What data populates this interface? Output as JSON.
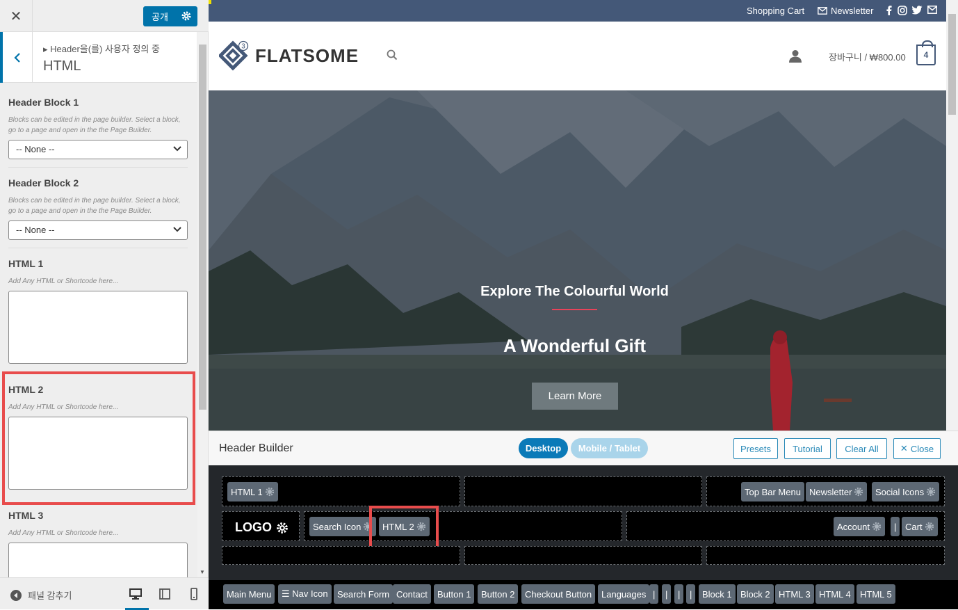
{
  "panel": {
    "close_label": "✕",
    "publish_label": "공개",
    "breadcrumb": "▸ Header을(를) 사용자 정의 중",
    "title": "HTML",
    "sections": {
      "header_block_1": {
        "title": "Header Block 1",
        "desc": "Blocks can be edited in the page builder. Select a block, go to a page and open in the the Page Builder.",
        "value": "-- None --"
      },
      "header_block_2": {
        "title": "Header Block 2",
        "desc": "Blocks can be edited in the page builder. Select a block, go to a page and open in the the Page Builder.",
        "value": "-- None --"
      },
      "html_1": {
        "title": "HTML 1",
        "desc": "Add Any HTML or Shortcode here..."
      },
      "html_2": {
        "title": "HTML 2",
        "desc": "Add Any HTML or Shortcode here..."
      },
      "html_3": {
        "title": "HTML 3",
        "desc": "Add Any HTML or Shortcode here..."
      }
    },
    "footer": {
      "hide_label": "패널 감추기"
    }
  },
  "preview": {
    "topbar": {
      "cart": "Shopping Cart",
      "newsletter": "Newsletter"
    },
    "header": {
      "logo_text": "FLATSOME",
      "logo_badge": "3",
      "cart_text": "장바구니 / ₩800.00",
      "cart_count": "4"
    },
    "hero": {
      "subtitle": "Explore The Colourful World",
      "title": "A Wonderful Gift",
      "button": "Learn More"
    }
  },
  "builder": {
    "title": "Header Builder",
    "desktop": "Desktop",
    "mobile": "Mobile / Tablet",
    "presets": "Presets",
    "tutorial": "Tutorial",
    "clear_all": "Clear All",
    "close": "Close",
    "top_left": [
      "HTML 1"
    ],
    "top_right": [
      "Top Bar Menu",
      "Newsletter",
      "Social Icons"
    ],
    "main_logo": "LOGO",
    "main_left": [
      "Search Icon",
      "HTML 2"
    ],
    "main_right": [
      "Account",
      "|",
      "Cart"
    ],
    "elements": [
      "Main Menu",
      "☰ Nav Icon",
      "Search Form",
      "Contact",
      "Button 1",
      "Button 2",
      "Checkout Button",
      "Languages",
      "|",
      "|",
      "|",
      "|",
      "Block 1",
      "Block 2",
      "HTML 3",
      "HTML 4",
      "HTML 5"
    ]
  },
  "colors": {
    "accent": "#0073aa",
    "topbar": "#445878",
    "highlight": "#e84c4c",
    "chip": "#5d6874"
  }
}
